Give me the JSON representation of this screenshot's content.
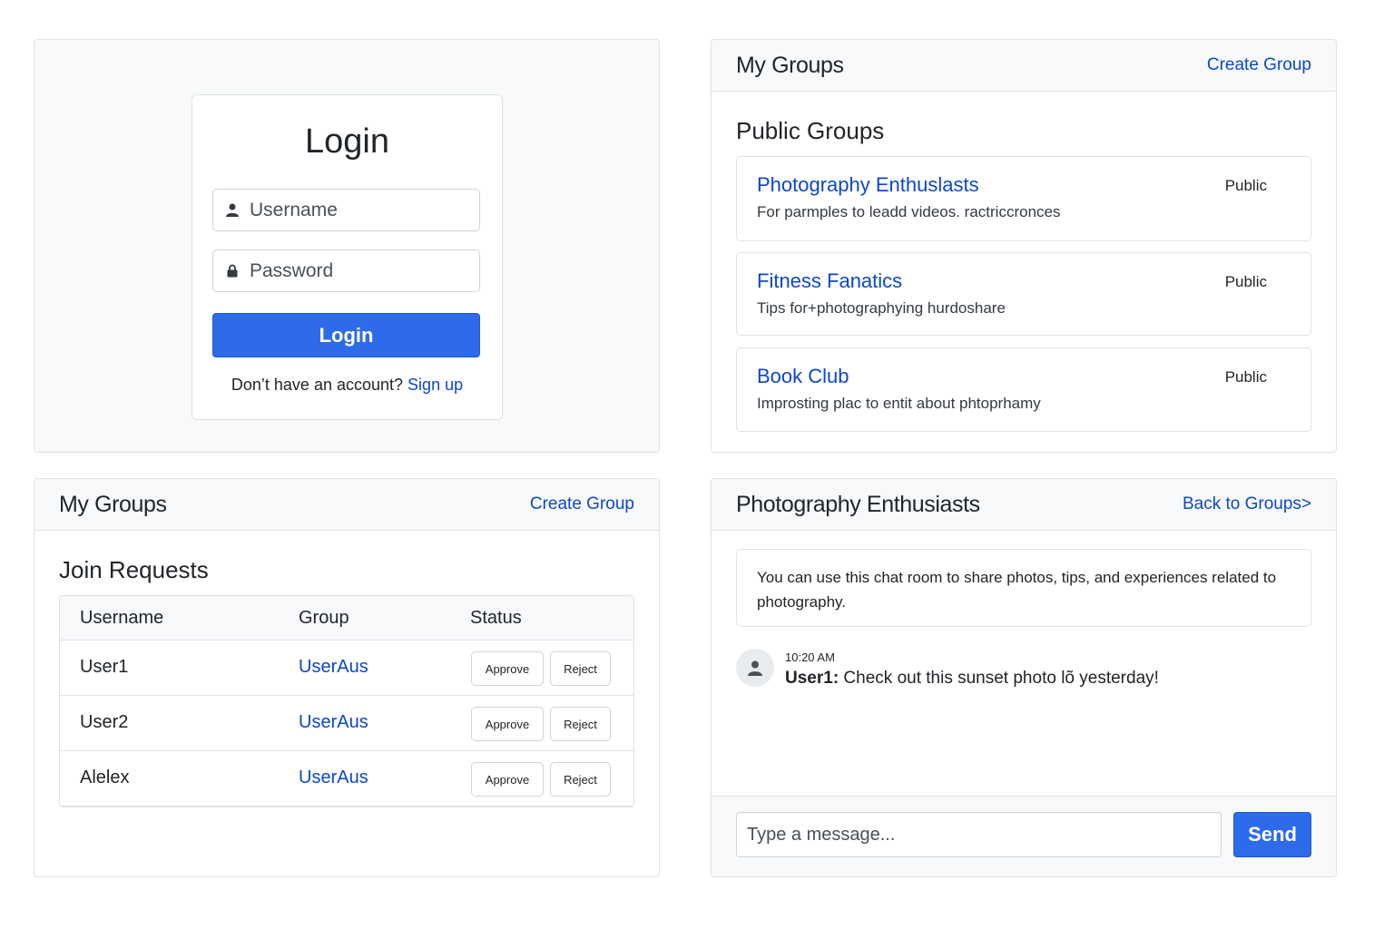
{
  "login": {
    "title": "Login",
    "username_placeholder": "Username",
    "password_placeholder": "Password",
    "button_label": "Login",
    "signup_prompt": "Don’t have an account?",
    "signup_link": "Sign up"
  },
  "groups_panel": {
    "title": "My Groups",
    "create_link": "Create Group",
    "section_title": "Public Groups",
    "groups": [
      {
        "name": "Photography Enthuslasts",
        "description": "For parmples to leadd videos. ractriccronces",
        "visibility": "Public"
      },
      {
        "name": "Fitness Fanatics",
        "description": "Tips for+photographying hurdoshare",
        "visibility": "Public"
      },
      {
        "name": "Book Club",
        "description": "Improsting plac to entit about phtoprhamy",
        "visibility": "Public"
      }
    ]
  },
  "requests_panel": {
    "title": "My Groups",
    "create_link": "Create Group",
    "section_title": "Join Requests",
    "columns": [
      "Username",
      "Group",
      "Status"
    ],
    "approve_label": "Approve",
    "reject_label": "Reject",
    "rows": [
      {
        "username": "User1",
        "group": "UserAus"
      },
      {
        "username": "User2",
        "group": "UserAus"
      },
      {
        "username": "Alelex",
        "group": "UserAus"
      }
    ]
  },
  "chat_panel": {
    "title": "Photography Enthusiasts",
    "back_link": "Back to Groups>",
    "intro": "You can use this chat room to share photos, tips, and experiences related to photography.",
    "messages": [
      {
        "time": "10:20 AM",
        "author": "User1:",
        "text": " Check out this sunset photo lõ yesterday!"
      }
    ],
    "input_placeholder": "Type a message...",
    "send_label": "Send"
  },
  "colors": {
    "accent": "#2d6bea",
    "link": "#0d47c9",
    "panel_bg": "#f8f9fa",
    "border": "#dee2e6"
  },
  "icons": [
    "user-icon",
    "lock-icon",
    "avatar-icon"
  ]
}
